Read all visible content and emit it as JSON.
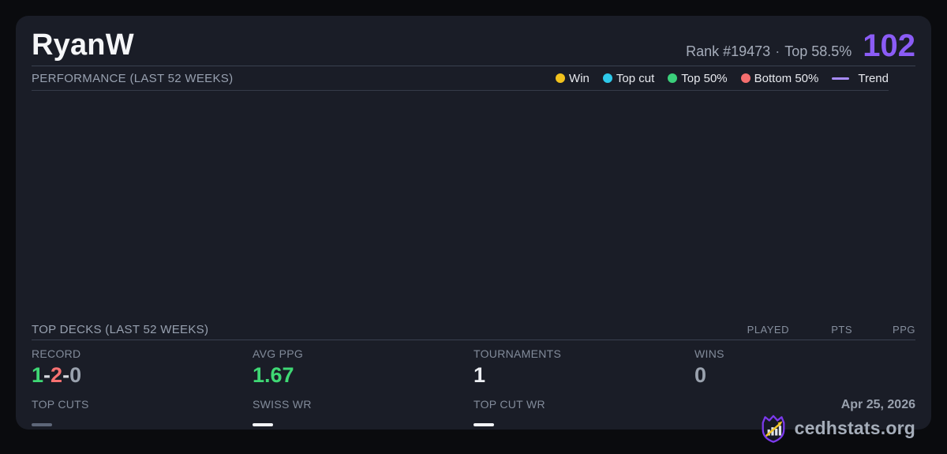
{
  "colors": {
    "card_bg": "#1a1d27",
    "page_bg": "#0a0b0e",
    "accent_purple": "#8b5cf6",
    "trend_purple": "#a78bfa",
    "win_gold": "#f2c21d",
    "topcut_cyan": "#2ec9ea",
    "top50_green": "#3bd07b",
    "bottom50_salmon": "#f56e6e",
    "value_green": "#3fd874",
    "value_red": "#f87171",
    "value_gray": "#9aa2ae"
  },
  "header": {
    "title": "RyanW",
    "rank_text": "Rank #19473",
    "separator": "·",
    "top_percent_text": "Top 58.5%",
    "score": "102"
  },
  "performance": {
    "label": "PERFORMANCE (LAST 52 WEEKS)",
    "legend": [
      {
        "label": "Win",
        "color": "#f2c21d",
        "icon": "win-dot-icon"
      },
      {
        "label": "Top cut",
        "color": "#2ec9ea",
        "icon": "topcut-dot-icon"
      },
      {
        "label": "Top 50%",
        "color": "#3bd07b",
        "icon": "top50-dot-icon"
      },
      {
        "label": "Bottom 50%",
        "color": "#f56e6e",
        "icon": "bottom50-dot-icon"
      }
    ],
    "trend": {
      "label": "Trend",
      "color": "#a78bfa",
      "icon": "trend-line-icon"
    }
  },
  "top_decks": {
    "label": "TOP DECKS (LAST 52 WEEKS)",
    "columns": [
      "PLAYED",
      "PTS",
      "PPG"
    ]
  },
  "stats": {
    "record": {
      "label": "RECORD",
      "wins": "1",
      "losses": "2",
      "draws": "0",
      "separator": "-"
    },
    "avg_ppg": {
      "label": "AVG PPG",
      "value": "1.67"
    },
    "tournaments": {
      "label": "TOURNAMENTS",
      "value": "1"
    },
    "wins": {
      "label": "WINS",
      "value": "0"
    },
    "top_cuts": {
      "label": "TOP CUTS",
      "dash_color": "#5d6678"
    },
    "swiss_wr": {
      "label": "SWISS WR",
      "dash_color": "#f2f4f7"
    },
    "top_cut_wr": {
      "label": "TOP CUT WR",
      "dash_color": "#f2f4f7"
    }
  },
  "footer": {
    "date": "Apr 25, 2026",
    "brand": "cedhstats.org",
    "brand_icon": "shield-chart-arrow-icon"
  }
}
